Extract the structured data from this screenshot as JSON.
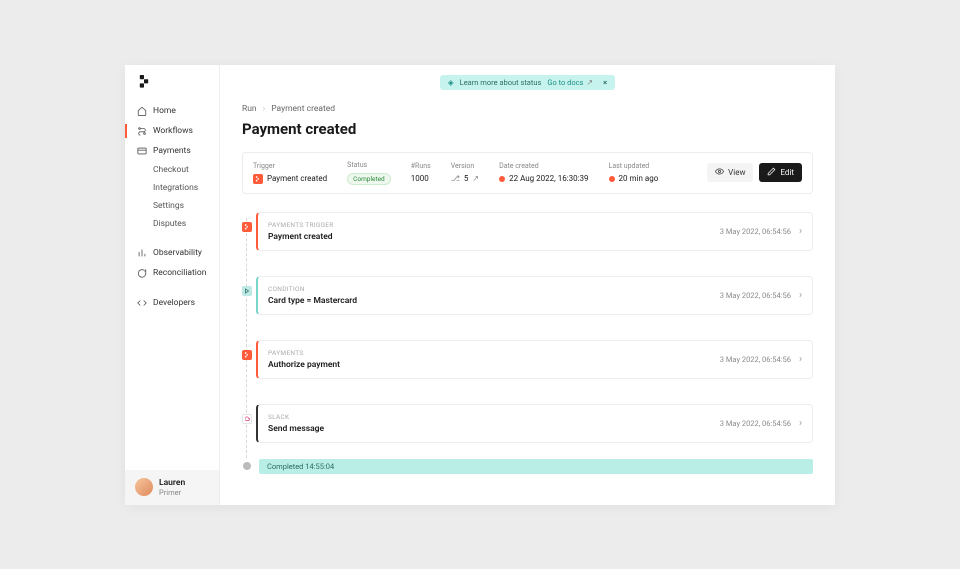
{
  "banner": {
    "text": "Learn more about status",
    "link": "Go to docs"
  },
  "sidebar": {
    "items": [
      {
        "icon": "home-icon",
        "label": "Home"
      },
      {
        "icon": "workflows-icon",
        "label": "Workflows"
      },
      {
        "icon": "payments-icon",
        "label": "Payments"
      }
    ],
    "payments_sub": [
      {
        "label": "Checkout"
      },
      {
        "label": "Integrations"
      },
      {
        "label": "Settings"
      },
      {
        "label": "Disputes"
      }
    ],
    "secondary": [
      {
        "icon": "observability-icon",
        "label": "Observability"
      },
      {
        "icon": "reconciliation-icon",
        "label": "Reconciliation"
      }
    ],
    "dev": {
      "icon": "developers-icon",
      "label": "Developers"
    }
  },
  "breadcrumbs": {
    "root": "Run",
    "current": "Payment created"
  },
  "page_title": "Payment created",
  "meta": {
    "trigger_label": "Trigger",
    "trigger_value": "Payment created",
    "status_label": "Status",
    "status_value": "Completed",
    "runs_label": "#Runs",
    "runs_value": "1000",
    "version_label": "Version",
    "version_value": "5",
    "date_created_label": "Date created",
    "date_created_value": "22 Aug 2022, 16:30:39",
    "last_updated_label": "Last updated",
    "last_updated_value": "20 min ago",
    "view_label": "View",
    "edit_label": "Edit"
  },
  "steps": [
    {
      "kicker": "PAYMENTS TRIGGER",
      "title": "Payment created",
      "time": "3 May 2022, 06:54:56",
      "accent": "orange"
    },
    {
      "kicker": "CONDITION",
      "title": "Card type = Mastercard",
      "time": "3 May 2022, 06:54:56",
      "accent": "teal"
    },
    {
      "kicker": "PAYMENTS",
      "title": "Authorize payment",
      "time": "3 May 2022, 06:54:56",
      "accent": "orange"
    },
    {
      "kicker": "SLACK",
      "title": "Send message",
      "time": "3 May 2022, 06:54:56",
      "accent": "dark"
    }
  ],
  "completed": {
    "label": "Completed 14:55:04"
  },
  "user": {
    "name": "Lauren",
    "org": "Primer"
  },
  "icons": {
    "branch": "⎇"
  }
}
